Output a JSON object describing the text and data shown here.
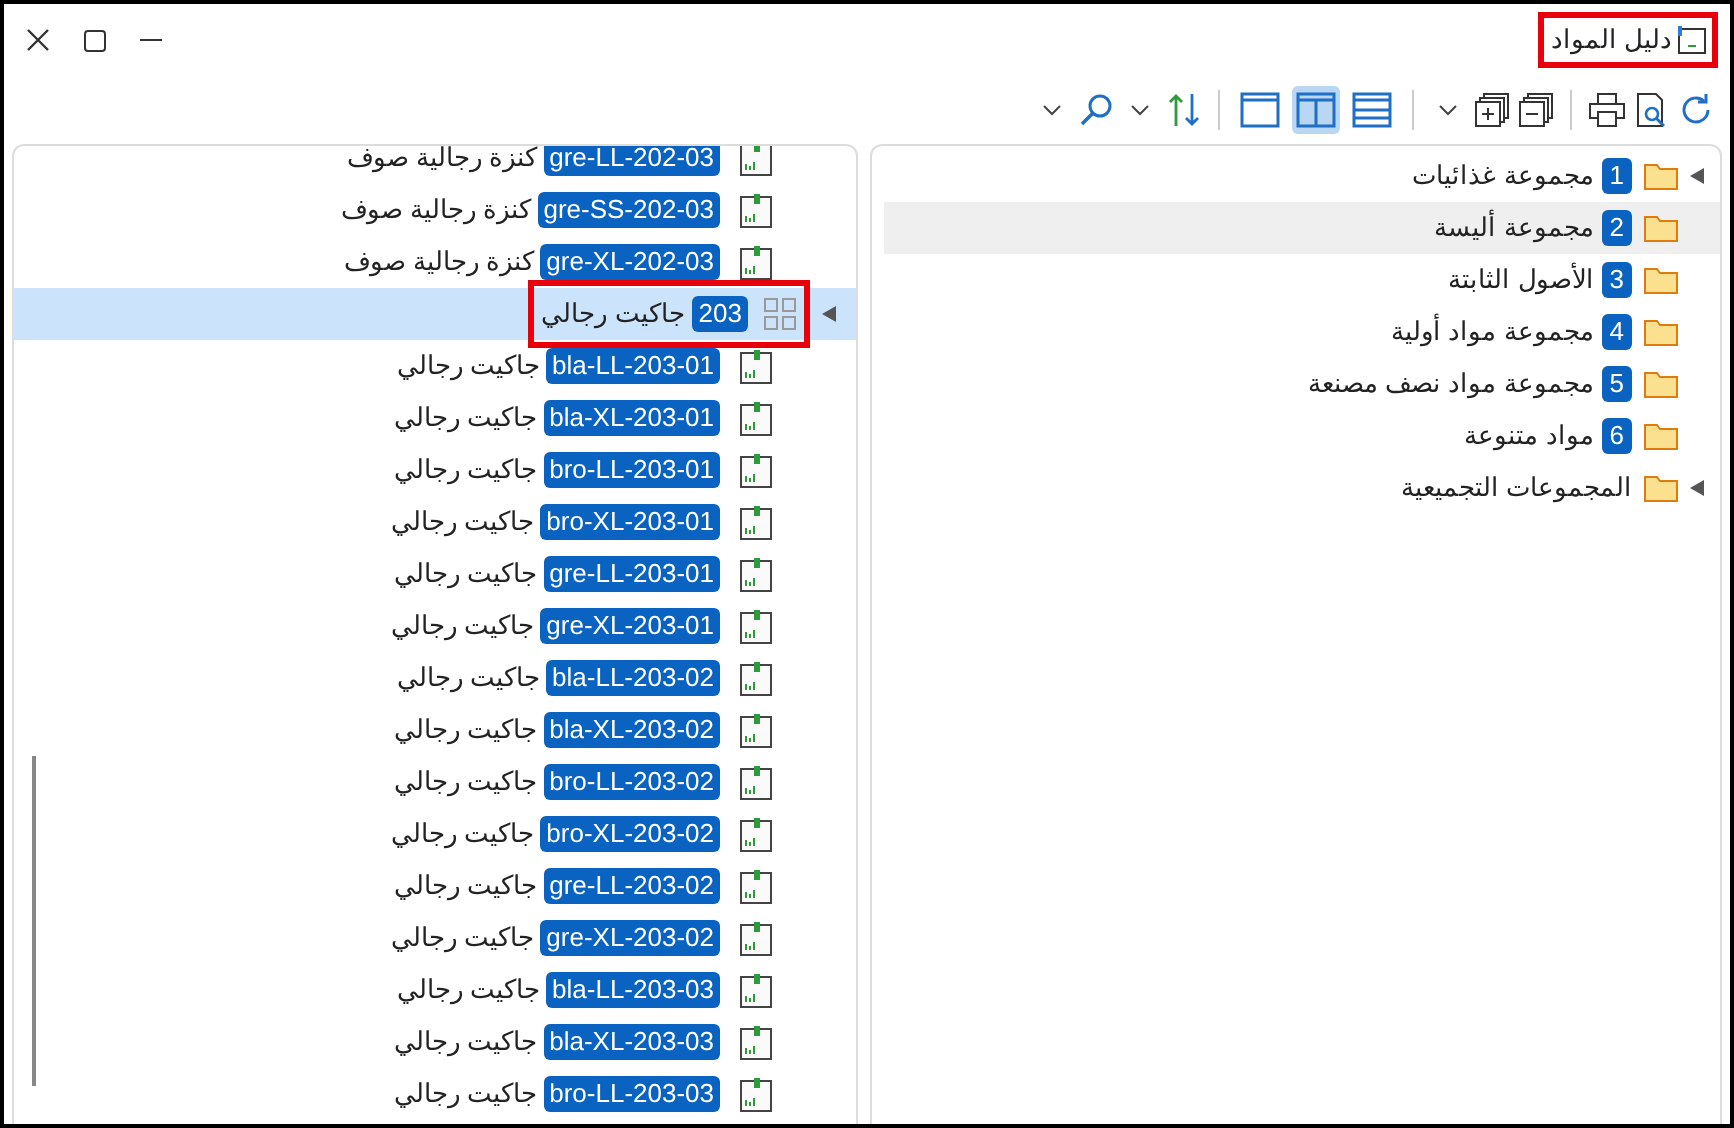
{
  "window": {
    "title": "دليل المواد",
    "title_highlighted": true
  },
  "toolbar": {
    "layouts": [
      {
        "kind": "rows",
        "selected": false
      },
      {
        "kind": "split",
        "selected": true
      },
      {
        "kind": "single",
        "selected": false
      }
    ]
  },
  "groups": [
    {
      "number": "1",
      "name": "مجموعة غذائيات",
      "expandable": true,
      "selected": false
    },
    {
      "number": "2",
      "name": "مجموعة أليسة",
      "expandable": false,
      "selected": true
    },
    {
      "number": "3",
      "name": "الأصول الثابتة",
      "expandable": false,
      "selected": false
    },
    {
      "number": "4",
      "name": "مجموعة مواد أولية",
      "expandable": false,
      "selected": false
    },
    {
      "number": "5",
      "name": "مجموعة مواد نصف مصنعة",
      "expandable": false,
      "selected": false
    },
    {
      "number": "6",
      "name": "مواد متنوعة",
      "expandable": false,
      "selected": false
    },
    {
      "name": "المجموعات التجميعية",
      "expandable": true,
      "selected": false
    }
  ],
  "materials": [
    {
      "kind": "item",
      "code": "gre-LL-202-03",
      "name": "كنزة رجالية صوف"
    },
    {
      "kind": "item",
      "code": "gre-SS-202-03",
      "name": "كنزة رجالية صوف"
    },
    {
      "kind": "item",
      "code": "gre-XL-202-03",
      "name": "كنزة رجالية صوف"
    },
    {
      "kind": "group",
      "code": "203",
      "name": "جاكيت رجالي",
      "selected": true,
      "highlighted": true,
      "children": [
        {
          "kind": "item",
          "code": "bla-LL-203-01",
          "name": "جاكيت رجالي"
        },
        {
          "kind": "item",
          "code": "bla-XL-203-01",
          "name": "جاكيت رجالي"
        },
        {
          "kind": "item",
          "code": "bro-LL-203-01",
          "name": "جاكيت رجالي"
        },
        {
          "kind": "item",
          "code": "bro-XL-203-01",
          "name": "جاكيت رجالي"
        },
        {
          "kind": "item",
          "code": "gre-LL-203-01",
          "name": "جاكيت رجالي"
        },
        {
          "kind": "item",
          "code": "gre-XL-203-01",
          "name": "جاكيت رجالي"
        },
        {
          "kind": "item",
          "code": "bla-LL-203-02",
          "name": "جاكيت رجالي"
        },
        {
          "kind": "item",
          "code": "bla-XL-203-02",
          "name": "جاكيت رجالي"
        },
        {
          "kind": "item",
          "code": "bro-LL-203-02",
          "name": "جاكيت رجالي"
        },
        {
          "kind": "item",
          "code": "bro-XL-203-02",
          "name": "جاكيت رجالي"
        },
        {
          "kind": "item",
          "code": "gre-LL-203-02",
          "name": "جاكيت رجالي"
        },
        {
          "kind": "item",
          "code": "gre-XL-203-02",
          "name": "جاكيت رجالي"
        },
        {
          "kind": "item",
          "code": "bla-LL-203-03",
          "name": "جاكيت رجالي"
        },
        {
          "kind": "item",
          "code": "bla-XL-203-03",
          "name": "جاكيت رجالي"
        },
        {
          "kind": "item",
          "code": "bro-LL-203-03",
          "name": "جاكيت رجالي"
        }
      ]
    }
  ]
}
